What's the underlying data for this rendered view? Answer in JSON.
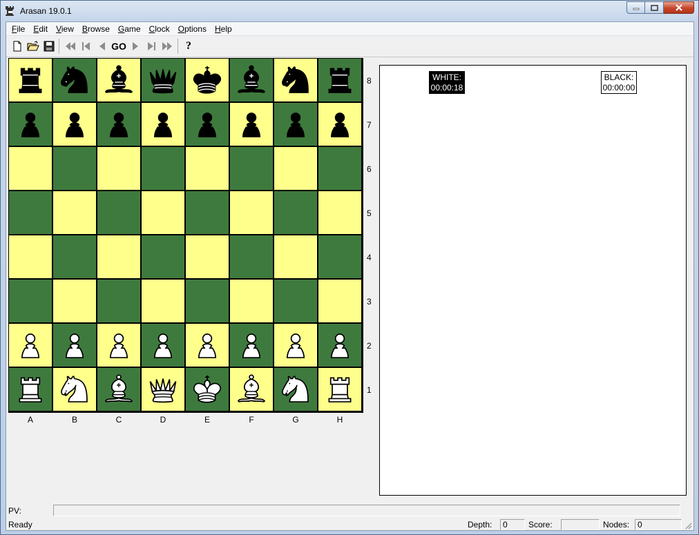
{
  "window": {
    "title": "Arasan 19.0.1"
  },
  "menu": [
    {
      "label": "File",
      "u": "F",
      "rest": "ile"
    },
    {
      "label": "Edit",
      "u": "E",
      "rest": "dit"
    },
    {
      "label": "View",
      "u": "V",
      "rest": "iew"
    },
    {
      "label": "Browse",
      "u": "B",
      "rest": "rowse"
    },
    {
      "label": "Game",
      "u": "G",
      "rest": "ame"
    },
    {
      "label": "Clock",
      "u": "C",
      "rest": "lock"
    },
    {
      "label": "Options",
      "u": "O",
      "rest": "ptions"
    },
    {
      "label": "Help",
      "u": "H",
      "rest": "elp"
    }
  ],
  "toolbar": {
    "go_label": "GO",
    "help_label": "?"
  },
  "board": {
    "colors": {
      "light": "#ffff8c",
      "dark": "#3e7a3e"
    },
    "ranks": [
      "8",
      "7",
      "6",
      "5",
      "4",
      "3",
      "2",
      "1"
    ],
    "files": [
      "A",
      "B",
      "C",
      "D",
      "E",
      "F",
      "G",
      "H"
    ],
    "position": [
      [
        "br",
        "bn",
        "bb",
        "bq",
        "bk",
        "bb",
        "bn",
        "br"
      ],
      [
        "bp",
        "bp",
        "bp",
        "bp",
        "bp",
        "bp",
        "bp",
        "bp"
      ],
      [
        "",
        "",
        "",
        "",
        "",
        "",
        "",
        ""
      ],
      [
        "",
        "",
        "",
        "",
        "",
        "",
        "",
        ""
      ],
      [
        "",
        "",
        "",
        "",
        "",
        "",
        "",
        ""
      ],
      [
        "",
        "",
        "",
        "",
        "",
        "",
        "",
        ""
      ],
      [
        "wp",
        "wp",
        "wp",
        "wp",
        "wp",
        "wp",
        "wp",
        "wp"
      ],
      [
        "wr",
        "wn",
        "wb",
        "wq",
        "wk",
        "wb",
        "wn",
        "wr"
      ]
    ]
  },
  "clocks": {
    "white": {
      "label": "WHITE:",
      "time": "00:00:18"
    },
    "black": {
      "label": "BLACK:",
      "time": "00:00:00"
    }
  },
  "status": {
    "pv_label": "PV:",
    "pv_value": "",
    "state": "Ready",
    "depth_label": "Depth:",
    "depth_value": "0",
    "score_label": "Score:",
    "score_value": "",
    "nodes_label": "Nodes:",
    "nodes_value": "0"
  }
}
